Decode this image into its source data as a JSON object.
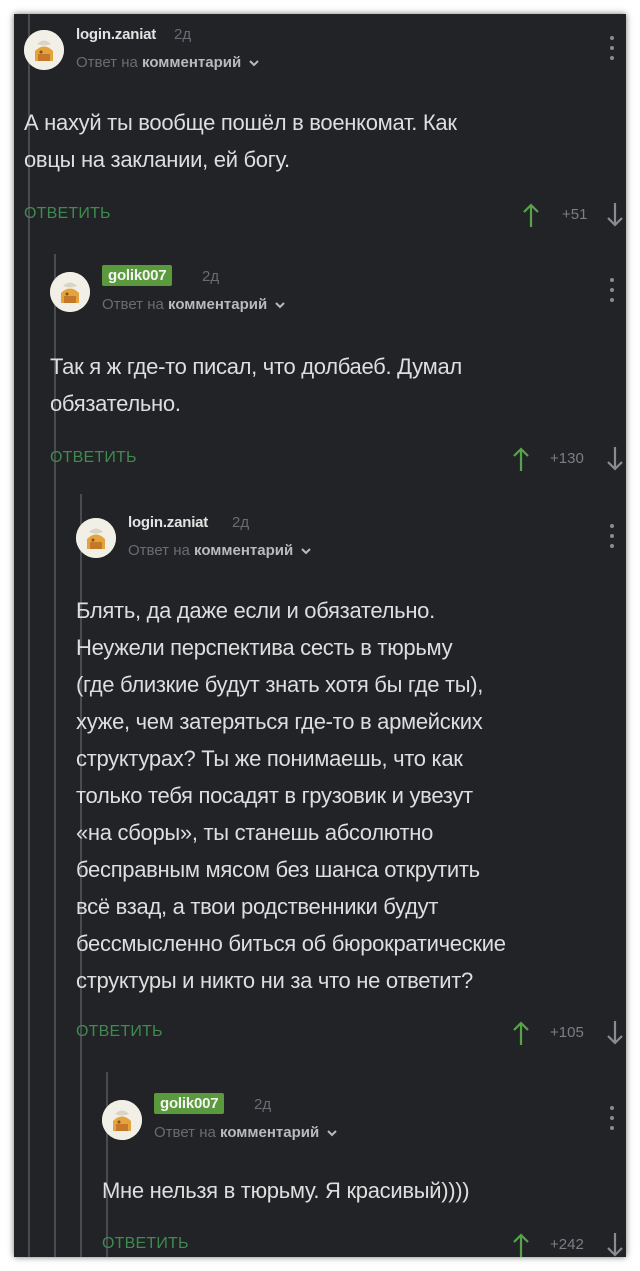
{
  "reply_to_prefix": "Ответ на",
  "reply_to_target": "комментарий",
  "reply_label": "ОТВЕТИТЬ",
  "colors": {
    "background": "#222327",
    "reply_green": "#3f8a4e",
    "upvote_green": "#58a34a",
    "username_badge": "#5b9a3c"
  },
  "comments": [
    {
      "username": "login.zaniat",
      "time": "2д",
      "text": [
        "А нахуй ты вообще пошёл в военкомат. Как",
        "овцы на заклании, ей богу."
      ],
      "rating": "+51"
    },
    {
      "username": "golik007",
      "time": "2д",
      "text": [
        "Так я ж где-то писал, что долбаеб. Думал",
        "обязательно."
      ],
      "rating": "+130"
    },
    {
      "username": "login.zaniat",
      "time": "2д",
      "text": [
        "Блять, да даже если и обязательно.",
        "Неужели перспектива сесть в тюрьму",
        "(где близкие будут знать хотя бы где ты),",
        "хуже, чем затеряться где-то в армейских",
        "структурах? Ты же понимаешь, что как",
        "только тебя посадят в грузовик и увезут",
        "«на сборы», ты станешь абсолютно",
        "бесправным мясом без шанса открутить",
        "всё взад, а твои родственники будут",
        "бессмысленно биться об бюрократические",
        "структуры и никто ни за что не ответит?"
      ],
      "rating": "+105"
    },
    {
      "username": "golik007",
      "time": "2д",
      "text": [
        "Мне нельзя в тюрьму. Я красивый))))"
      ],
      "rating": "+242"
    }
  ]
}
